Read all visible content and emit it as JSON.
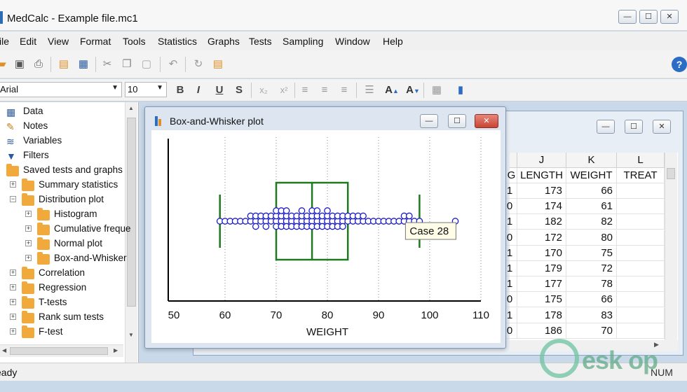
{
  "window": {
    "title": "MedCalc - Example file.mc1",
    "min": "—",
    "max": "☐",
    "close": "✕"
  },
  "menu": [
    "ile",
    "Edit",
    "View",
    "Format",
    "Tools",
    "Statistics",
    "Graphs",
    "Tests",
    "Sampling",
    "Window",
    "Help"
  ],
  "format_bar": {
    "font": "Arial",
    "size": "10",
    "bold": "B",
    "italic": "I",
    "underline": "U",
    "shadow": "S",
    "subscript": "x₂",
    "superscript": "x²"
  },
  "tree": {
    "items": [
      {
        "label": "Data",
        "icon": "grid-icon",
        "level": 0
      },
      {
        "label": "Notes",
        "icon": "notes-icon",
        "level": 0
      },
      {
        "label": "Variables",
        "icon": "variables-icon",
        "level": 0
      },
      {
        "label": "Filters",
        "icon": "filter-icon",
        "level": 0
      },
      {
        "label": "Saved tests and graphs",
        "icon": "folder-icon",
        "level": 0
      },
      {
        "label": "Summary statistics",
        "icon": "folder-icon",
        "level": 1
      },
      {
        "label": "Distribution plot",
        "icon": "folder-icon",
        "level": 1
      },
      {
        "label": "Histogram",
        "icon": "folder-icon",
        "level": 2
      },
      {
        "label": "Cumulative freque",
        "icon": "folder-icon",
        "level": 2
      },
      {
        "label": "Normal plot",
        "icon": "folder-icon",
        "level": 2
      },
      {
        "label": "Box-and-Whisker",
        "icon": "folder-icon",
        "level": 2
      },
      {
        "label": "Correlation",
        "icon": "folder-icon",
        "level": 1
      },
      {
        "label": "Regression",
        "icon": "folder-icon",
        "level": 1
      },
      {
        "label": "T-tests",
        "icon": "folder-icon",
        "level": 1
      },
      {
        "label": "Rank sum tests",
        "icon": "folder-icon",
        "level": 1
      },
      {
        "label": "F-test",
        "icon": "folder-icon",
        "level": 1
      }
    ]
  },
  "sheet": {
    "columns": [
      {
        "letter": "J",
        "field": "LENGTH"
      },
      {
        "letter": "K",
        "field": "WEIGHT"
      },
      {
        "letter": "L",
        "field": "TREAT"
      }
    ],
    "partial_field": "G",
    "rows": [
      {
        "g": "1",
        "length": "173",
        "weight": "66"
      },
      {
        "g": "0",
        "length": "174",
        "weight": "61"
      },
      {
        "g": "1",
        "length": "182",
        "weight": "82"
      },
      {
        "g": "0",
        "length": "172",
        "weight": "80"
      },
      {
        "g": "1",
        "length": "170",
        "weight": "75"
      },
      {
        "g": "1",
        "length": "179",
        "weight": "72"
      },
      {
        "g": "1",
        "length": "177",
        "weight": "78"
      },
      {
        "g": "0",
        "length": "175",
        "weight": "66"
      },
      {
        "g": "1",
        "length": "178",
        "weight": "83"
      },
      {
        "g": "0",
        "length": "186",
        "weight": "70"
      }
    ]
  },
  "plot_window": {
    "title": "Box-and-Whisker plot"
  },
  "chart_data": {
    "type": "box",
    "xlabel": "WEIGHT",
    "xlim": [
      48,
      111
    ],
    "xticks": [
      50,
      60,
      70,
      80,
      90,
      100,
      110
    ],
    "box": {
      "whisker_low": 59,
      "q1": 70,
      "median": 77,
      "q3": 84,
      "whisker_high": 98
    },
    "points": [
      59,
      60,
      61,
      62,
      63,
      64,
      65,
      65,
      66,
      66,
      66,
      67,
      67,
      68,
      68,
      68,
      69,
      69,
      70,
      70,
      70,
      70,
      71,
      71,
      71,
      71,
      72,
      72,
      72,
      72,
      73,
      73,
      73,
      74,
      74,
      74,
      75,
      75,
      75,
      75,
      76,
      76,
      76,
      77,
      77,
      77,
      77,
      78,
      78,
      78,
      78,
      79,
      79,
      79,
      80,
      80,
      80,
      80,
      81,
      81,
      81,
      82,
      82,
      82,
      83,
      83,
      83,
      84,
      84,
      85,
      85,
      86,
      86,
      87,
      87,
      88,
      89,
      90,
      91,
      92,
      93,
      94,
      95,
      95,
      96,
      96,
      97,
      98,
      105
    ],
    "tooltip": "Case 28",
    "grid": "vertical dotted"
  },
  "status": {
    "text": "eady",
    "num": "NUM"
  },
  "watermark": "esk op",
  "colors": {
    "box": "#1e7a1e",
    "point": "#1a1acc",
    "folder": "#f2a93b"
  }
}
